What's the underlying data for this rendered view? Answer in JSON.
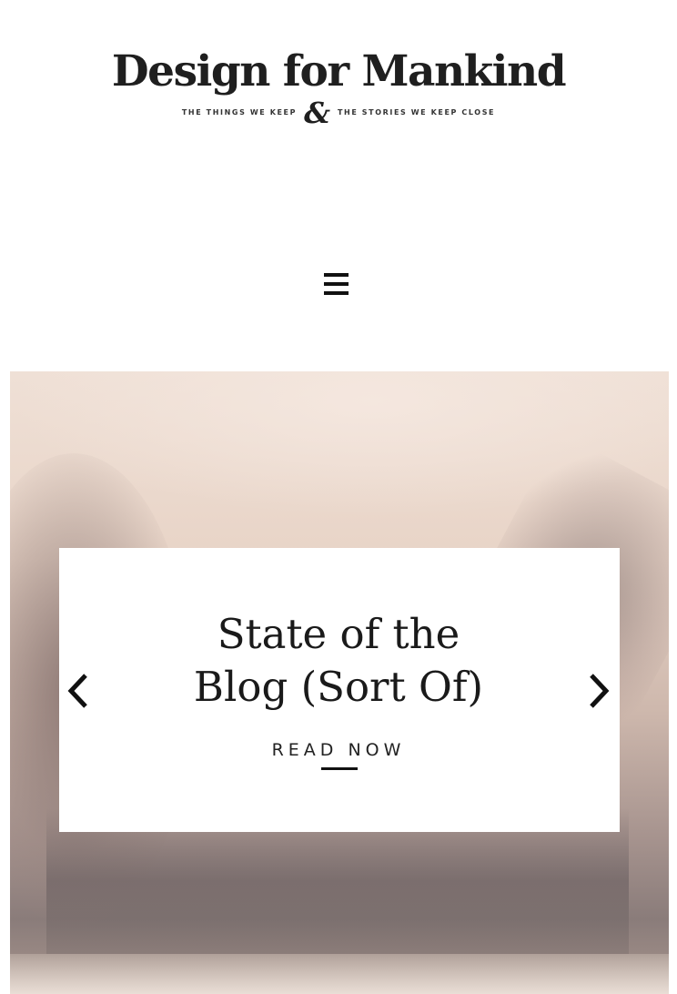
{
  "header": {
    "site_title": "Design for Mankind",
    "tagline_left": "THE THINGS WE KEEP",
    "tagline_ampersand": "&",
    "tagline_right": "THE STORIES WE KEEP CLOSE",
    "menu_icon": "hamburger-menu-icon"
  },
  "hero_slider": {
    "slide_title": "State of the Blog (Sort Of)",
    "cta_label": "READ NOW",
    "prev_icon": "chevron-left-icon",
    "next_icon": "chevron-right-icon"
  },
  "colors": {
    "text_dark": "#1a1a1a",
    "background": "#ffffff",
    "hero_tint": "#e8d4c7"
  }
}
